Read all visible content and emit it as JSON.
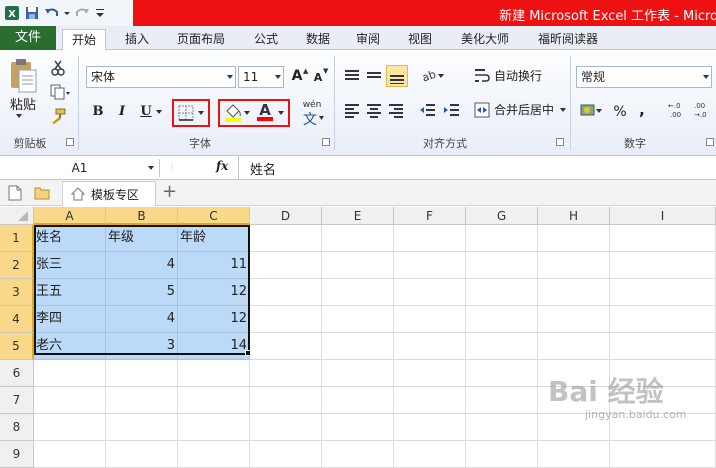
{
  "window": {
    "title": "新建 Microsoft Excel 工作表 - Micro"
  },
  "tabs": [
    {
      "label": "文件"
    },
    {
      "label": "开始"
    },
    {
      "label": "插入"
    },
    {
      "label": "页面布局"
    },
    {
      "label": "公式"
    },
    {
      "label": "数据"
    },
    {
      "label": "审阅"
    },
    {
      "label": "视图"
    },
    {
      "label": "美化大师"
    },
    {
      "label": "福昕阅读器"
    }
  ],
  "ribbon": {
    "clipboard": {
      "label": "剪贴板",
      "paste": "粘贴"
    },
    "font": {
      "label": "字体",
      "name": "宋体",
      "size": "11",
      "wen": "wén",
      "bold": "B",
      "italic": "I",
      "underline": "U",
      "grow": "A",
      "shrink": "A"
    },
    "alignment": {
      "label": "对齐方式",
      "wrap": "自动换行",
      "merge": "合并后居中"
    },
    "number": {
      "label": "数字",
      "format": "常规",
      "percent": "%",
      "comma": ",",
      "inc": "+.0 .00",
      "dec": ".00 +.0"
    },
    "colors": {
      "fill": "#ffff00",
      "font": "#ff0000"
    }
  },
  "formula_bar": {
    "name_box": "A1",
    "fx": "fx",
    "content": "姓名"
  },
  "doc_tabs": {
    "template_tab": "模板专区",
    "add": "+"
  },
  "sheet": {
    "columns": [
      "A",
      "B",
      "C",
      "D",
      "E",
      "F",
      "G",
      "H",
      "I"
    ],
    "rows": [
      "1",
      "2",
      "3",
      "4",
      "5",
      "6",
      "7",
      "8",
      "9"
    ],
    "cells": [
      [
        "姓名",
        "年级",
        "年龄"
      ],
      [
        "张三",
        "4",
        "11"
      ],
      [
        "王五",
        "5",
        "12"
      ],
      [
        "李四",
        "4",
        "12"
      ],
      [
        "老六",
        "3",
        "14"
      ]
    ]
  },
  "watermark": {
    "brand": "Bai 经验",
    "url": "jingyan.baidu.com"
  }
}
